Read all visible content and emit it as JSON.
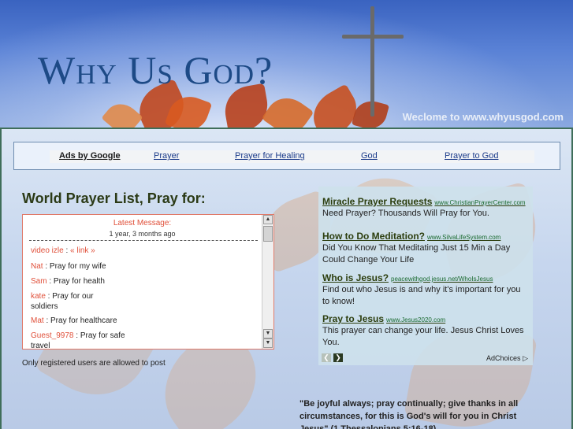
{
  "header": {
    "site_title": "Why Us God?",
    "welcome": "Weclome to www.whyusgod.com"
  },
  "ads_bar": {
    "label": "Ads by Google",
    "links": [
      "Prayer",
      "Prayer for Healing",
      "God",
      "Prayer to God"
    ]
  },
  "prayer_list": {
    "title": "World Prayer List, Pray for:",
    "latest_label": "Latest Message:",
    "latest_time": "1 year, 3 months ago",
    "messages": [
      {
        "user": "video izle",
        "sep": " : ",
        "text": "« link »"
      },
      {
        "user": "Nat",
        "sep": " : ",
        "text": "Pray for my wife"
      },
      {
        "user": "Sam",
        "sep": " : ",
        "text": "Pray for health"
      },
      {
        "user": "kate",
        "sep": " : ",
        "text": "Pray for our soldiers"
      },
      {
        "user": "Mat",
        "sep": " : ",
        "text": "Pray for healthcare"
      },
      {
        "user": "Guest_9978",
        "sep": " : ",
        "text": "Pray for safe travel"
      }
    ],
    "notice": "Only registered users are allowed to post"
  },
  "google_ads": {
    "ads": [
      {
        "title": "Miracle Prayer Requests",
        "url": "www.ChristianPrayerCenter.com",
        "body": "Need Prayer? Thousands Will Pray for You."
      },
      {
        "title": "How to Do Meditation?",
        "url": "www.SilvaLifeSystem.com",
        "body": "Did You Know That Meditating Just 15 Min a Day Could Change Your Life"
      },
      {
        "title": "Who is Jesus?",
        "url": "peacewithgod.jesus.net/WhoIsJesus",
        "body": "Find out who Jesus is and why it's important for you to know!"
      },
      {
        "title": "Pray to Jesus",
        "url": "www.Jesus2020.com",
        "body": "This prayer can change your life. Jesus Christ Loves You."
      }
    ],
    "adchoices": "AdChoices"
  },
  "verse": "\"Be joyful always; pray continually; give thanks in all circumstances, for this is God's will for you in Christ Jesus\" (1 Thessalonians 5:16-18)",
  "icons": {
    "prev": "chevron-left-icon",
    "next": "chevron-right-icon",
    "adchoices": "adchoices-triangle-icon"
  }
}
